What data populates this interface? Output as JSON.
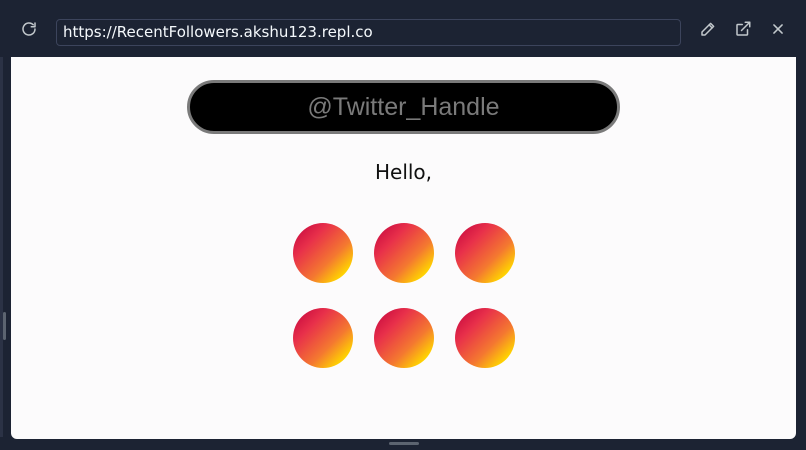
{
  "toolbar": {
    "url": "https://RecentFollowers.akshu123.repl.co"
  },
  "page": {
    "handle_placeholder": "@Twitter_Handle",
    "greeting": "Hello,",
    "avatars": [
      {
        "id": 1
      },
      {
        "id": 2
      },
      {
        "id": 3
      },
      {
        "id": 4
      },
      {
        "id": 5
      },
      {
        "id": 6
      }
    ]
  },
  "colors": {
    "toolbar_bg": "#1c2333",
    "page_bg": "#fcfbfc",
    "input_bg": "#000000",
    "input_text": "#7a7a7a",
    "avatar_gradient_start": "#c0003d",
    "avatar_gradient_end": "#fff000"
  },
  "icons": {
    "reload": "reload-icon",
    "edit": "pencil-icon",
    "open_new_tab": "external-link-icon",
    "close": "close-icon"
  }
}
